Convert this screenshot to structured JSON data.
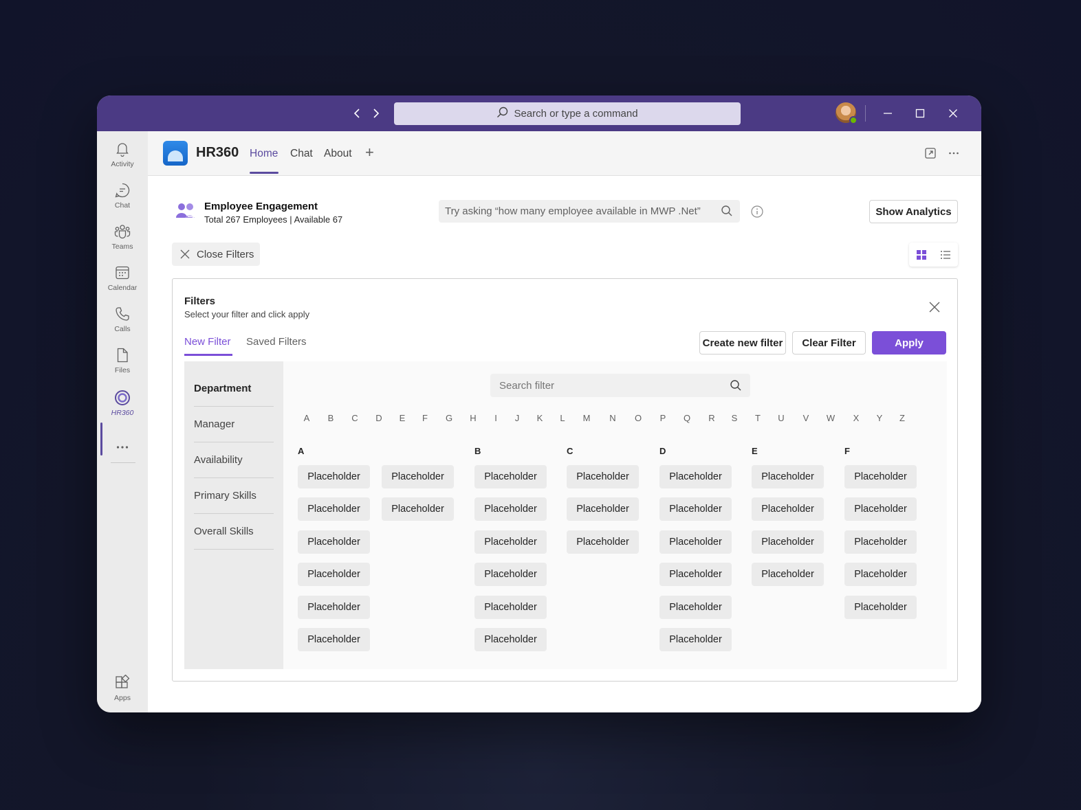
{
  "titlebar": {
    "search_placeholder": "Search or type a command",
    "icons": [
      "chevron-left-icon",
      "chevron-right-icon",
      "search-icon",
      "minimize-icon",
      "maximize-icon",
      "close-icon"
    ]
  },
  "rail": {
    "items": [
      {
        "label": "Activity",
        "icon": "bell-icon"
      },
      {
        "label": "Chat",
        "icon": "chat-icon"
      },
      {
        "label": "Teams",
        "icon": "teams-icon"
      },
      {
        "label": "Calendar",
        "icon": "calendar-icon"
      },
      {
        "label": "Calls",
        "icon": "phone-icon"
      },
      {
        "label": "Files",
        "icon": "file-icon"
      },
      {
        "label": "HR360",
        "icon": "hr360-icon"
      },
      {
        "label": "Apps",
        "icon": "apps-icon"
      }
    ],
    "more_label": "..."
  },
  "app": {
    "name": "HR360",
    "tabs": [
      {
        "label": "Home",
        "active": true
      },
      {
        "label": "Chat",
        "active": false
      },
      {
        "label": "About",
        "active": false
      }
    ],
    "add_tab": "+"
  },
  "main": {
    "title": "Employee Engagement",
    "subtitle": "Total 267 Employees | Available 67",
    "ask_placeholder": "Try asking “how many employee available in MWP  .Net”",
    "show_analytics": "Show Analytics",
    "close_filters": "Close Filters"
  },
  "filters": {
    "title": "Filters",
    "subtitle": "Select your filter and click apply",
    "tabs": [
      "New Filter",
      "Saved Filters"
    ],
    "buttons": {
      "create": "Create new filter",
      "clear": "Clear Filter",
      "apply": "Apply"
    },
    "categories": [
      "Department",
      "Manager",
      "Availability",
      "Primary Skills",
      "Overall Skills"
    ],
    "search_placeholder": "Search filter",
    "alphabet": [
      "A",
      "B",
      "C",
      "D",
      "E",
      "F",
      "G",
      "H",
      "I",
      "J",
      "K",
      "L",
      "M",
      "N",
      "O",
      "P",
      "Q",
      "R",
      "S",
      "T",
      "U",
      "V",
      "W",
      "X",
      "Y",
      "Z"
    ],
    "groups": [
      {
        "letter": "A",
        "items": [
          "Placeholder",
          "Placeholder",
          "Placeholder",
          "Placeholder",
          "Placeholder",
          "Placeholder",
          "Placeholder",
          "Placeholder"
        ]
      },
      {
        "letter": "B",
        "items": [
          "Placeholder",
          "Placeholder",
          "Placeholder",
          "Placeholder",
          "Placeholder",
          "Placeholder"
        ]
      },
      {
        "letter": "C",
        "items": [
          "Placeholder",
          "Placeholder",
          "Placeholder"
        ]
      },
      {
        "letter": "D",
        "items": [
          "Placeholder",
          "Placeholder",
          "Placeholder",
          "Placeholder",
          "Placeholder",
          "Placeholder"
        ]
      },
      {
        "letter": "E",
        "items": [
          "Placeholder",
          "Placeholder",
          "Placeholder",
          "Placeholder"
        ]
      },
      {
        "letter": "F",
        "items": [
          "Placeholder",
          "Placeholder",
          "Placeholder",
          "Placeholder",
          "Placeholder"
        ]
      }
    ]
  },
  "colors": {
    "titlebar": "#4b3a84",
    "accent": "#7b4fd8",
    "brand": "#5b4b9f"
  }
}
